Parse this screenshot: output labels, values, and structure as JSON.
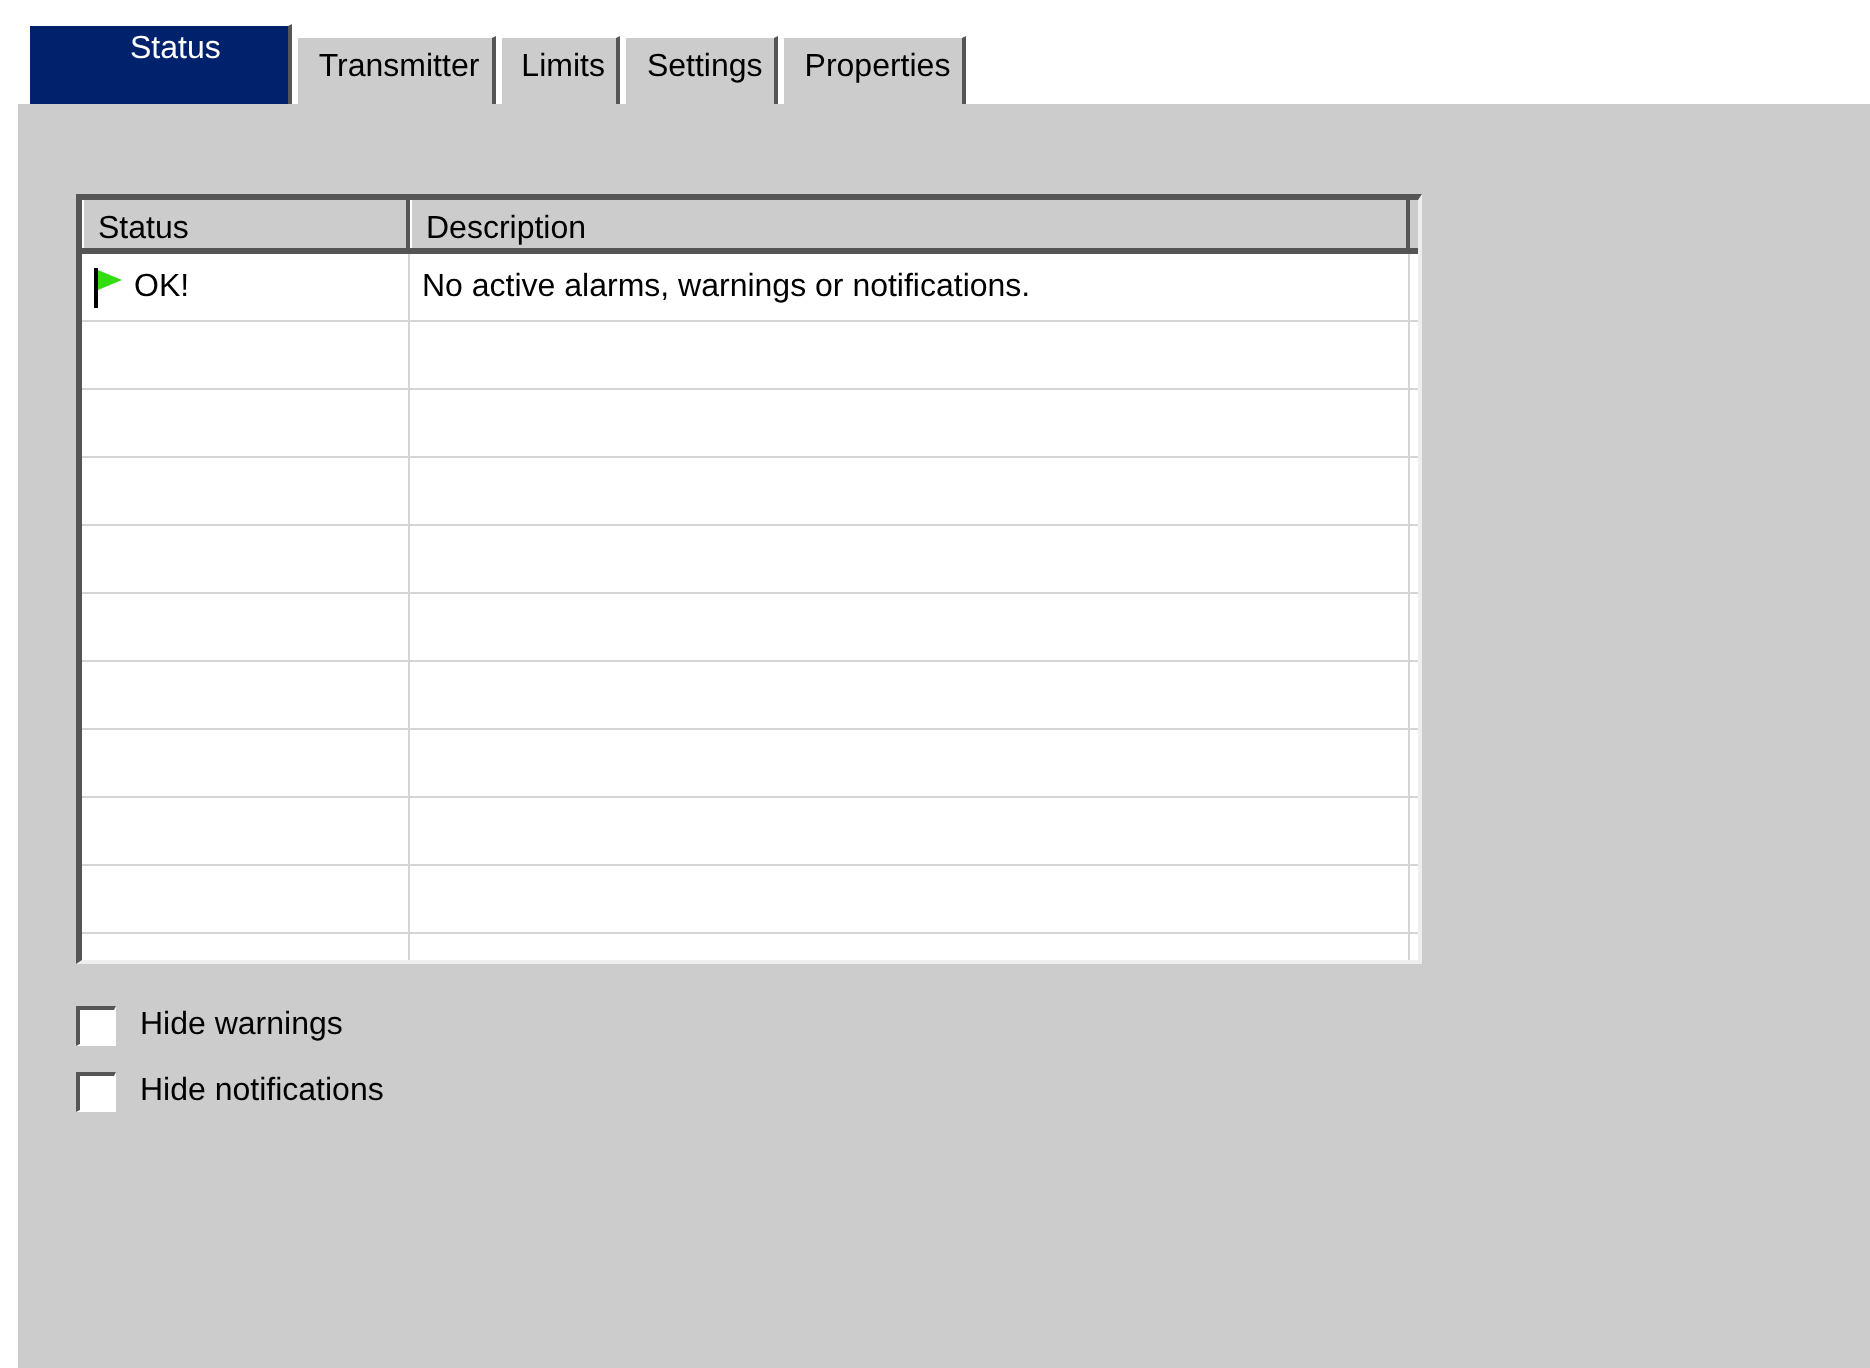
{
  "tabs": [
    {
      "label": "Status",
      "selected": true
    },
    {
      "label": "Transmitter",
      "selected": false
    },
    {
      "label": "Limits",
      "selected": false
    },
    {
      "label": "Settings",
      "selected": false
    },
    {
      "label": "Properties",
      "selected": false
    }
  ],
  "table": {
    "columns": [
      "Status",
      "Description"
    ],
    "rows": [
      {
        "status": "OK!",
        "description": "No active alarms, warnings or notifications."
      }
    ]
  },
  "checkboxes": [
    {
      "label": "Hide warnings",
      "checked": false
    },
    {
      "label": "Hide notifications",
      "checked": false
    }
  ]
}
